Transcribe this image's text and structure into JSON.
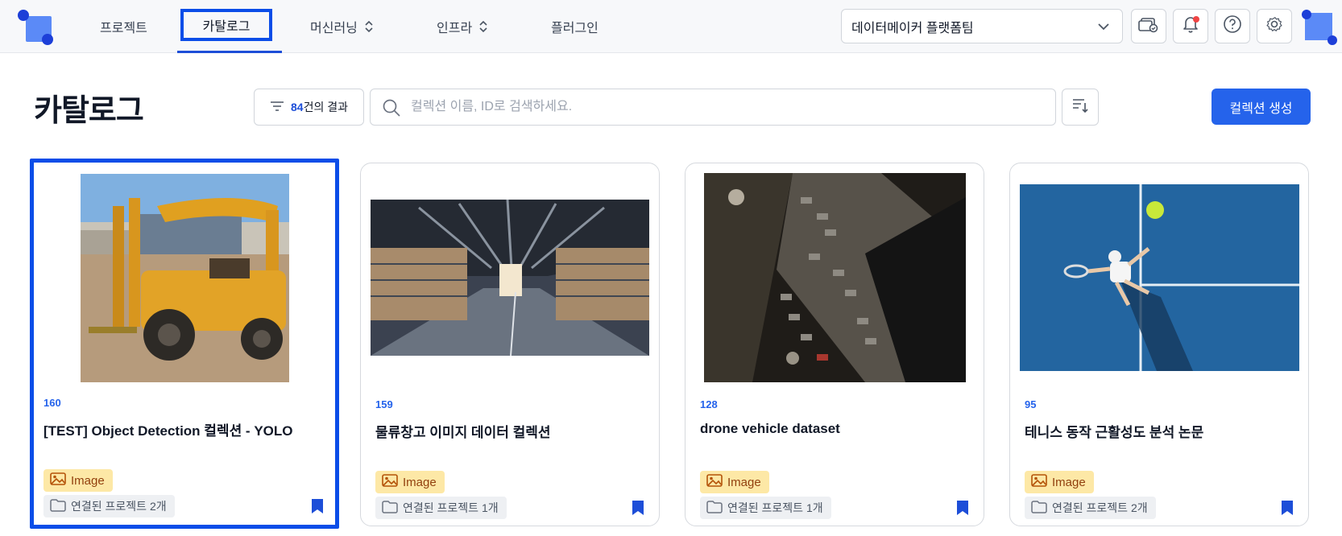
{
  "nav": {
    "items": [
      {
        "label": "프로젝트"
      },
      {
        "label": "카탈로그"
      },
      {
        "label": "머신러닝"
      },
      {
        "label": "인프라"
      },
      {
        "label": "플러그인"
      }
    ],
    "active": "카탈로그"
  },
  "workspace": {
    "selected": "데이터메이커 플랫폼팀"
  },
  "header_icons": [
    "billing-icon",
    "bell-icon",
    "help-icon",
    "gear-icon"
  ],
  "toolbar": {
    "title": "카탈로그",
    "result_count": "84",
    "result_suffix": "건의 결과",
    "search_placeholder": "컬렉션 이름, ID로 검색하세요.",
    "create_label": "컬렉션 생성"
  },
  "cards": [
    {
      "id": "160",
      "title": "[TEST] Object Detection 컬렉션 - YOLO",
      "type": "Image",
      "projects": "연결된 프로젝트 2개",
      "image": "forklift"
    },
    {
      "id": "159",
      "title": "물류창고 이미지 데이터 컬렉션",
      "type": "Image",
      "projects": "연결된 프로젝트 1개",
      "image": "warehouse"
    },
    {
      "id": "128",
      "title": "drone vehicle dataset",
      "type": "Image",
      "projects": "연결된 프로젝트 1개",
      "image": "drone-parking-lot"
    },
    {
      "id": "95",
      "title": "테니스 동작 근활성도 분석 논문",
      "type": "Image",
      "projects": "연결된 프로젝트 2개",
      "image": "tennis-player"
    }
  ],
  "colors": {
    "accent": "#2563eb",
    "selection": "#0b4de8",
    "image_tag_bg": "#fde8a6",
    "notification": "#ef4444"
  }
}
